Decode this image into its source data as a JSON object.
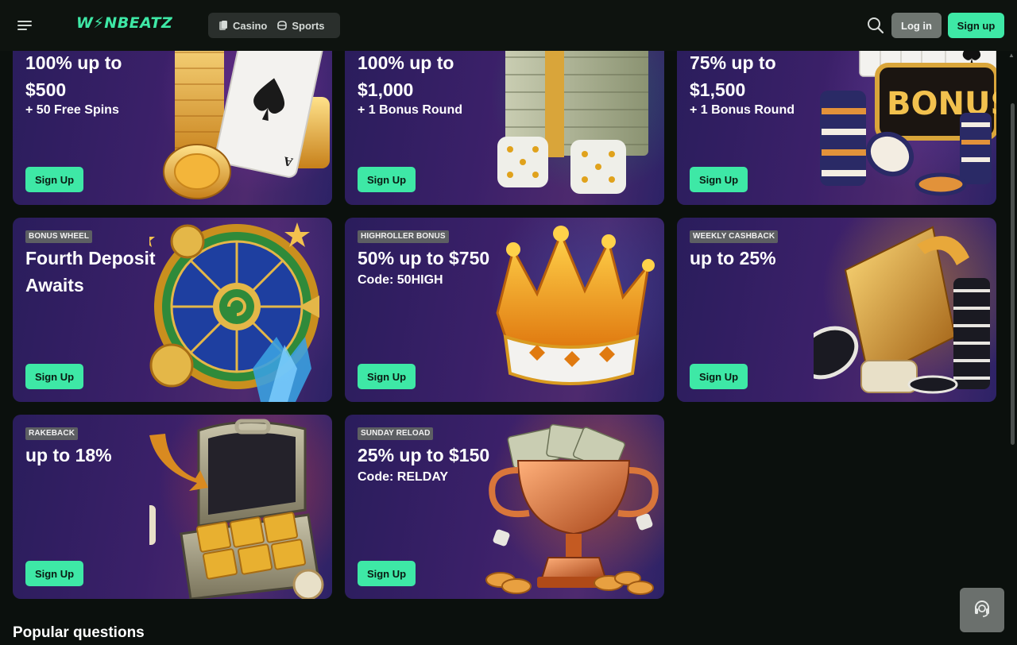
{
  "header": {
    "logo": "W⚡NBEATZ",
    "nav": [
      {
        "label": "Casino",
        "icon": "casino-icon"
      },
      {
        "label": "Sports",
        "icon": "sports-icon"
      }
    ],
    "login_label": "Log in",
    "signup_label": "Sign up"
  },
  "colors": {
    "accent": "#3ee8a6",
    "background": "#0b100d",
    "card_gradient": [
      "#2a1d5c",
      "#4e2a6e"
    ]
  },
  "cards": [
    {
      "badge": "",
      "title": "100% up to $500",
      "title_lines": [
        "100% up to",
        "$500"
      ],
      "subtitle": "+ 50 Free Spins",
      "cta": "Sign Up",
      "art": "coins-and-ace-card"
    },
    {
      "badge": "",
      "title": "100% up to $1,000",
      "title_lines": [
        "100% up to",
        "$1,000"
      ],
      "subtitle": "+ 1 Bonus Round",
      "cta": "Sign Up",
      "art": "cash-stack-and-dice"
    },
    {
      "badge": "",
      "title": "75% up to $1,500",
      "title_lines": [
        "75% up to",
        "$1,500"
      ],
      "subtitle": "+ 1 Bonus Round",
      "cta": "Sign Up",
      "art": "bonus-sign-cards-chips"
    },
    {
      "badge": "BONUS WHEEL",
      "title": "Fourth Deposit Awaits",
      "title_lines": [
        "Fourth Deposit",
        "Awaits"
      ],
      "subtitle": "",
      "cta": "Sign Up",
      "art": "bonus-wheel"
    },
    {
      "badge": "HIGHROLLER BONUS",
      "title": "50% up to $750",
      "title_lines": [
        "50% up to $750"
      ],
      "subtitle": "Code: 50HIGH",
      "cta": "Sign Up",
      "art": "golden-crown"
    },
    {
      "badge": "WEEKLY CASHBACK",
      "title": "up to 25%",
      "title_lines": [
        "up to 25%"
      ],
      "subtitle": "",
      "cta": "Sign Up",
      "art": "gold-card-and-chips"
    },
    {
      "badge": "RAKEBACK",
      "title": "up to 18%",
      "title_lines": [
        "up to 18%"
      ],
      "subtitle": "",
      "cta": "Sign Up",
      "art": "gold-briefcase"
    },
    {
      "badge": "SUNDAY RELOAD",
      "title": "25% up to $150",
      "title_lines": [
        "25% up to $150"
      ],
      "subtitle": "Code: RELDAY",
      "cta": "Sign Up",
      "art": "trophy-with-cash"
    }
  ],
  "section_title": "Popular questions",
  "support_icon": "headset-icon"
}
